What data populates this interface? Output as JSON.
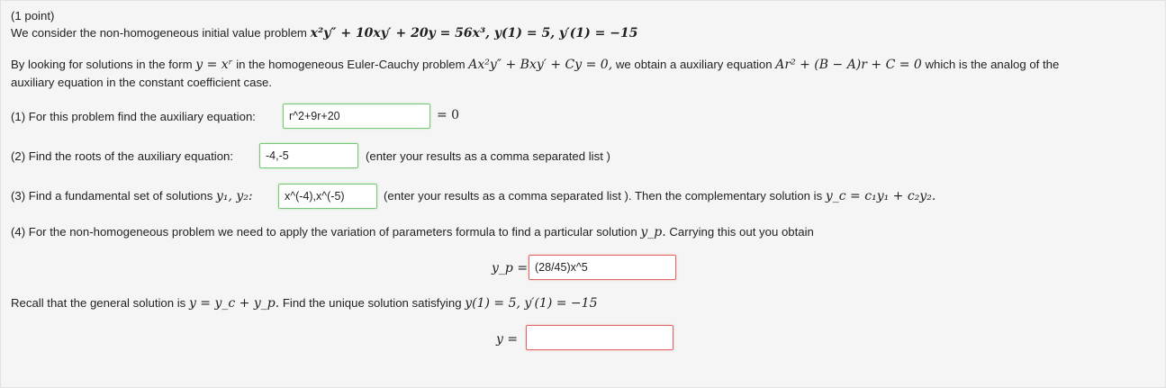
{
  "header": {
    "points": "(1 point)"
  },
  "intro": {
    "text": "We consider the non-homogeneous initial value problem",
    "equation": "x²y″ + 10xy′ + 20y = 56x³,  y(1) = 5,  y′(1) = −15"
  },
  "euler": {
    "p1": "By looking for solutions in the form",
    "form": "y = xʳ",
    "p2": "in the homogeneous Euler-Cauchy problem",
    "problem": "Ax²y″ + Bxy′ + Cy = 0,",
    "p3": "we obtain a auxiliary equation",
    "aux": "Ar² + (B − A)r + C = 0",
    "p4": "which is the analog of the",
    "p5": "auxiliary equation in the constant coefficient case."
  },
  "q1": {
    "label": "(1) For this problem find the auxiliary equation:",
    "value": "r^2+9r+20",
    "suffix": "= 0"
  },
  "q2": {
    "label": "(2) Find the roots of the auxiliary equation:",
    "value": "-4,-5",
    "note": "(enter your results as a comma separated list )"
  },
  "q3": {
    "label": "(3) Find a fundamental set of solutions",
    "vars": "y₁, y₂:",
    "value": "x^(-4),x^(-5)",
    "note": "(enter your results as a comma separated list ). Then the complementary solution is",
    "yc": "y_c = c₁y₁ + c₂y₂."
  },
  "q4": {
    "label": "(4) For the non-homogeneous problem we need to apply the variation of parameters formula to find a particular solution",
    "yp": "y_p.",
    "tail": "Carrying this out you obtain",
    "yp_label": "y_p =",
    "yp_value": "(28/45)x^5"
  },
  "final": {
    "text": "Recall that the general solution is",
    "eq": "y = y_c + y_p.",
    "text2": "Find the unique solution satisfying",
    "ic": "y(1) = 5,  y′(1) = −15",
    "y_label": "y =",
    "y_value": ""
  }
}
